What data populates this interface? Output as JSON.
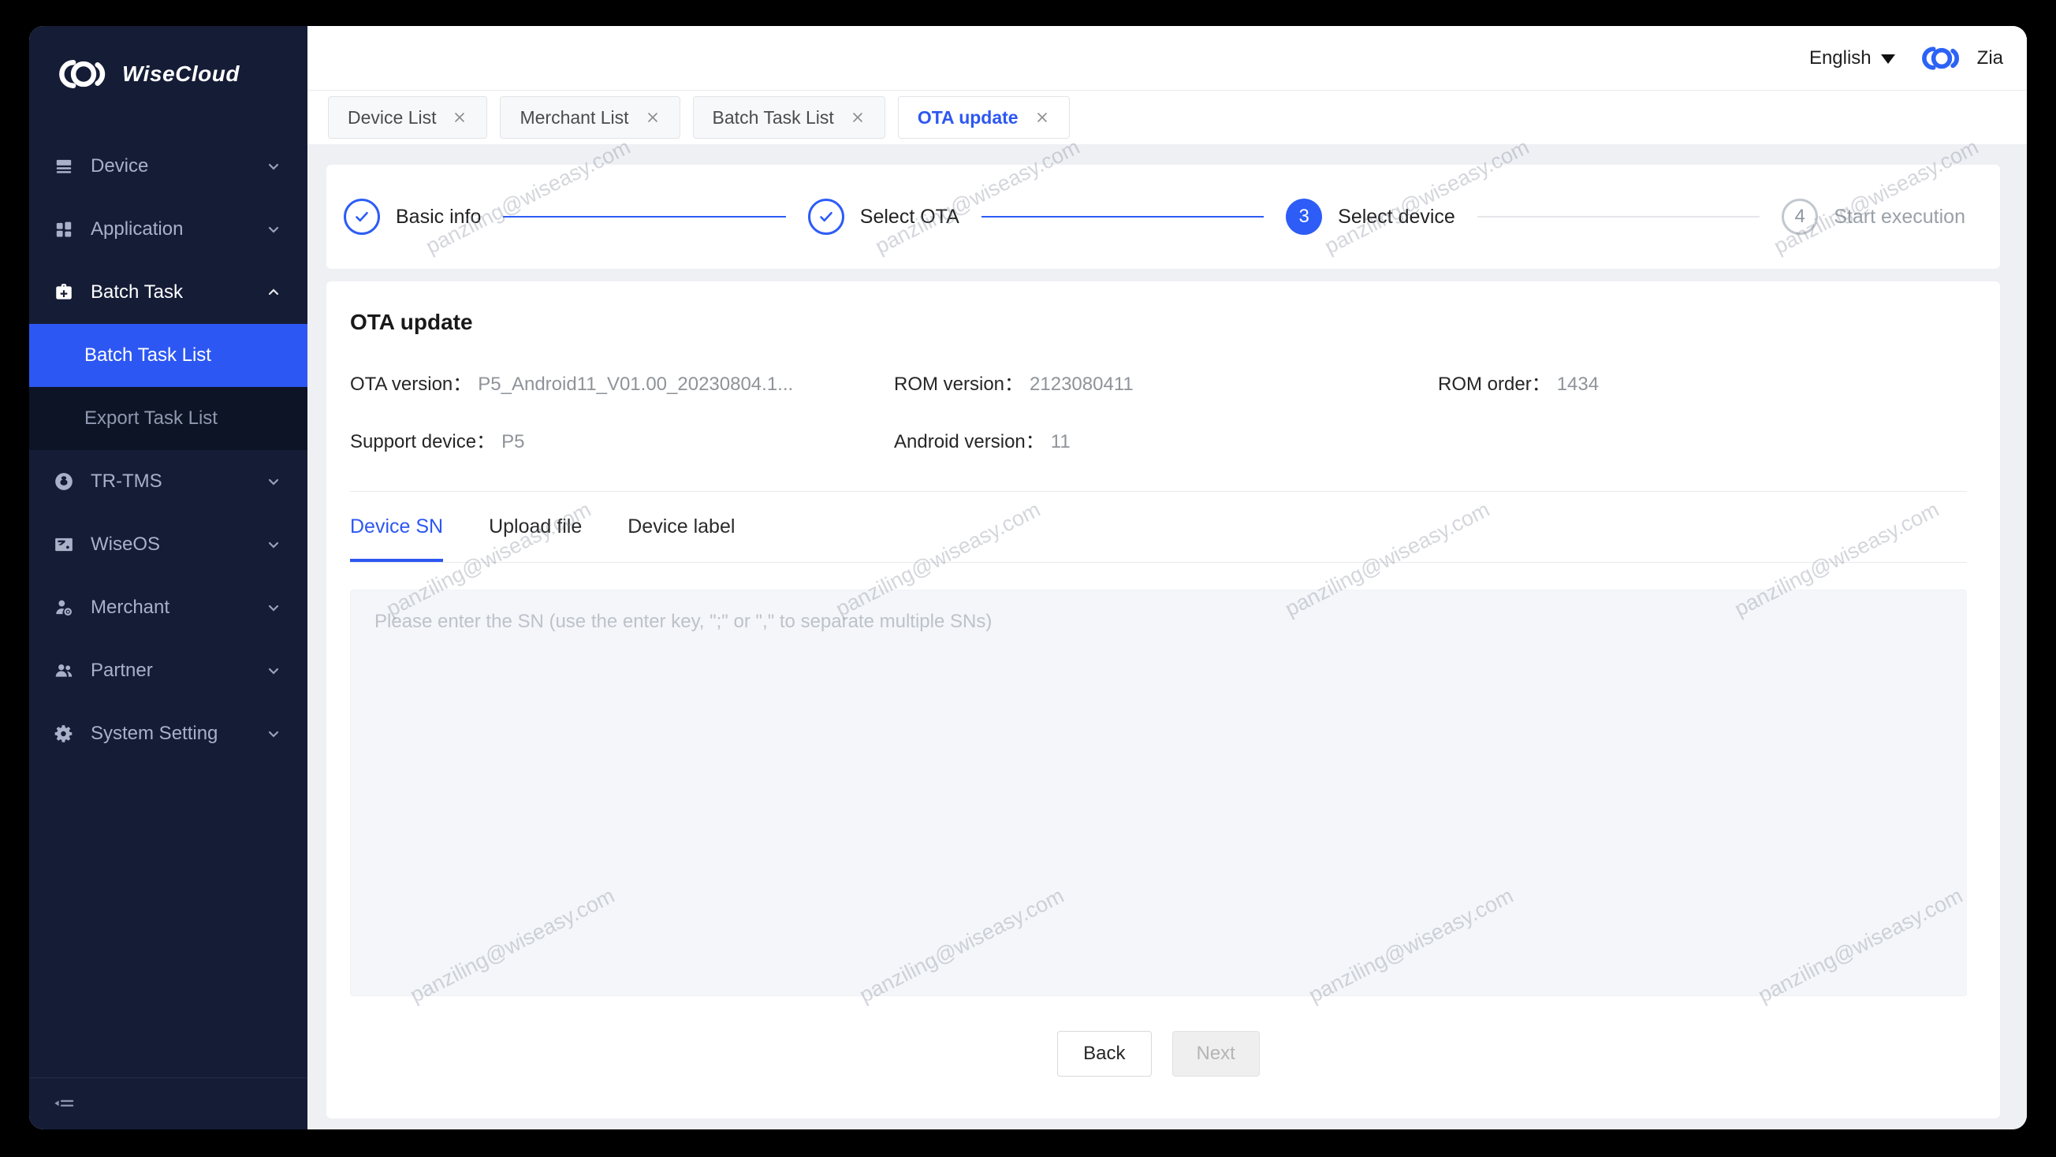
{
  "brand": {
    "name": "WiseCloud"
  },
  "header": {
    "language": "English",
    "user": "Zia"
  },
  "sidebar": {
    "items": [
      {
        "label": "Device",
        "icon": "device-icon"
      },
      {
        "label": "Application",
        "icon": "application-icon"
      },
      {
        "label": "Batch Task",
        "icon": "batch-task-icon",
        "expanded": true,
        "children": [
          {
            "label": "Batch Task List",
            "selected": true
          },
          {
            "label": "Export Task List"
          }
        ]
      },
      {
        "label": "TR-TMS",
        "icon": "tr-tms-icon"
      },
      {
        "label": "WiseOS",
        "icon": "wiseos-icon"
      },
      {
        "label": "Merchant",
        "icon": "merchant-icon"
      },
      {
        "label": "Partner",
        "icon": "partner-icon"
      },
      {
        "label": "System Setting",
        "icon": "gear-icon"
      }
    ]
  },
  "tabs": [
    {
      "label": "Device List"
    },
    {
      "label": "Merchant List"
    },
    {
      "label": "Batch Task List"
    },
    {
      "label": "OTA update",
      "active": true
    }
  ],
  "stepper": [
    {
      "label": "Basic info",
      "state": "done"
    },
    {
      "label": "Select OTA",
      "state": "done"
    },
    {
      "label": "Select device",
      "state": "current",
      "number": "3"
    },
    {
      "label": "Start execution",
      "state": "pending",
      "number": "4"
    }
  ],
  "card": {
    "title": "OTA update",
    "fields": [
      {
        "label": "OTA version：",
        "value": "P5_Android11_V01.00_20230804.1..."
      },
      {
        "label": "ROM version：",
        "value": "2123080411"
      },
      {
        "label": "ROM order：",
        "value": "1434"
      },
      {
        "label": "Support device：",
        "value": "P5"
      },
      {
        "label": "Android version：",
        "value": "11"
      }
    ],
    "tabs": [
      {
        "label": "Device SN",
        "active": true
      },
      {
        "label": "Upload file"
      },
      {
        "label": "Device label"
      }
    ],
    "sn_placeholder": "Please enter the SN (use the enter key, \";\" or \",\" to separate multiple SNs)",
    "back_label": "Back",
    "next_label": "Next"
  },
  "watermark": {
    "text": "panziling@wiseasy.com"
  },
  "colors": {
    "accent": "#2d57f2",
    "stepper_blue": "#2d5cf6",
    "sidebar_bg": "#151c36",
    "submenu_bg": "#0d1426",
    "content_bg": "#eef0f4",
    "muted_text": "#8f9399"
  }
}
